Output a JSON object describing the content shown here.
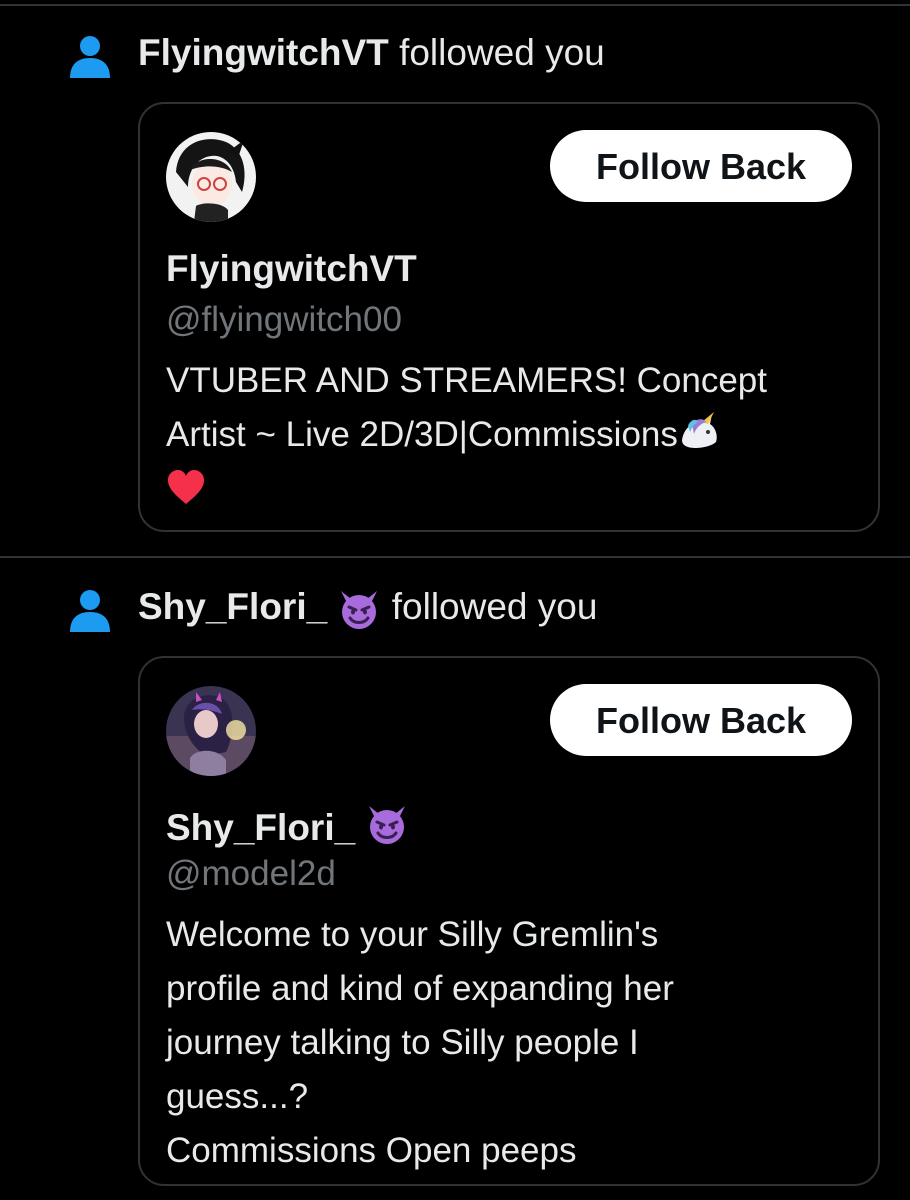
{
  "notifications": [
    {
      "name": "FlyingwitchVT",
      "name_emoji": "",
      "action": "followed you",
      "card": {
        "display_name": "FlyingwitchVT",
        "handle": "@flyingwitch00",
        "follow_label": "Follow Back",
        "bio_line1": "VTUBER AND STREAMERS! Concept",
        "bio_line2": "Artist ~ Live 2D/3D|Commissions"
      }
    },
    {
      "name": "Shy_Flori_",
      "name_emoji": "smiling-imp-emoji",
      "action": "followed you",
      "card": {
        "display_name": "Shy_Flori_",
        "handle": "@model2d",
        "follow_label": "Follow Back",
        "bio_line1": "Welcome to your Silly Gremlin's",
        "bio_line2": "profile and kind of expanding her",
        "bio_line3": "journey talking to Silly people I",
        "bio_line4": "guess...?",
        "bio_line5": "Commissions Open peeps"
      }
    }
  ],
  "colors": {
    "background": "#000000",
    "accent_blue": "#1d9bf0",
    "text": "#e7e9ea",
    "muted": "#71767b",
    "border": "#2f3336"
  }
}
